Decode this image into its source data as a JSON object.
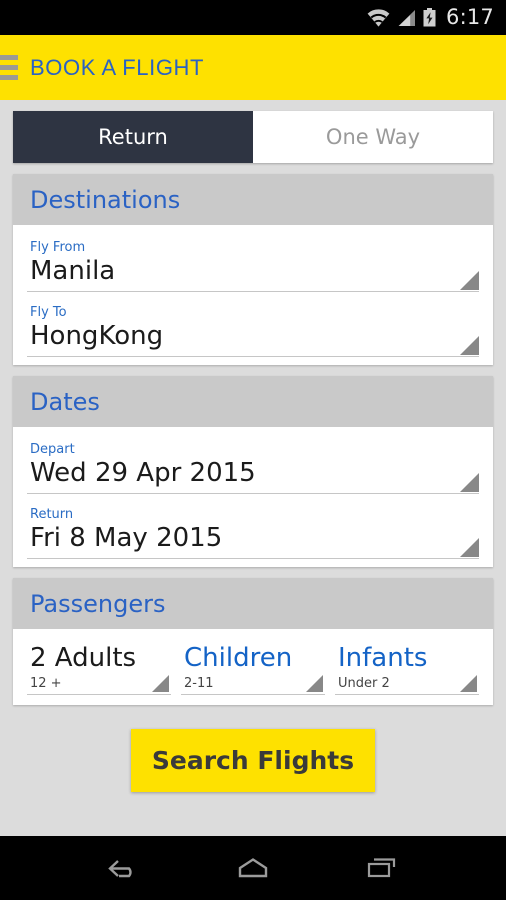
{
  "status_bar": {
    "time": "6:17",
    "icons": [
      "wifi-icon",
      "signal-icon",
      "battery-charging-icon"
    ]
  },
  "app_bar": {
    "menu_icon": "hamburger-menu-icon",
    "title": "BOOK A FLIGHT",
    "background": "#fee100",
    "title_color": "#2a62c4"
  },
  "trip_type_tabs": {
    "active_index": 0,
    "tabs": [
      {
        "label": "Return",
        "active": true
      },
      {
        "label": "One Way",
        "active": false
      }
    ],
    "active_bg": "#2e3442",
    "inactive_fg": "#9a9a9a"
  },
  "sections": {
    "destinations": {
      "title": "Destinations",
      "fields": [
        {
          "label": "Fly From",
          "value": "Manila"
        },
        {
          "label": "Fly To",
          "value": "HongKong"
        }
      ]
    },
    "dates": {
      "title": "Dates",
      "fields": [
        {
          "label": "Depart",
          "value": "Wed 29 Apr 2015"
        },
        {
          "label": "Return",
          "value": "Fri 8 May 2015"
        }
      ]
    },
    "passengers": {
      "title": "Passengers",
      "columns": [
        {
          "value": "2 Adults",
          "sub": "12 +",
          "filled": true
        },
        {
          "value": "Children",
          "sub": "2-11",
          "filled": false
        },
        {
          "value": "Infants",
          "sub": "Under 2",
          "filled": false
        }
      ]
    }
  },
  "search_button": {
    "label": "Search Flights",
    "background": "#fee100",
    "text_color": "#3a3a3a"
  },
  "nav_bar": {
    "buttons": [
      "back-icon",
      "home-icon",
      "recents-icon"
    ]
  }
}
